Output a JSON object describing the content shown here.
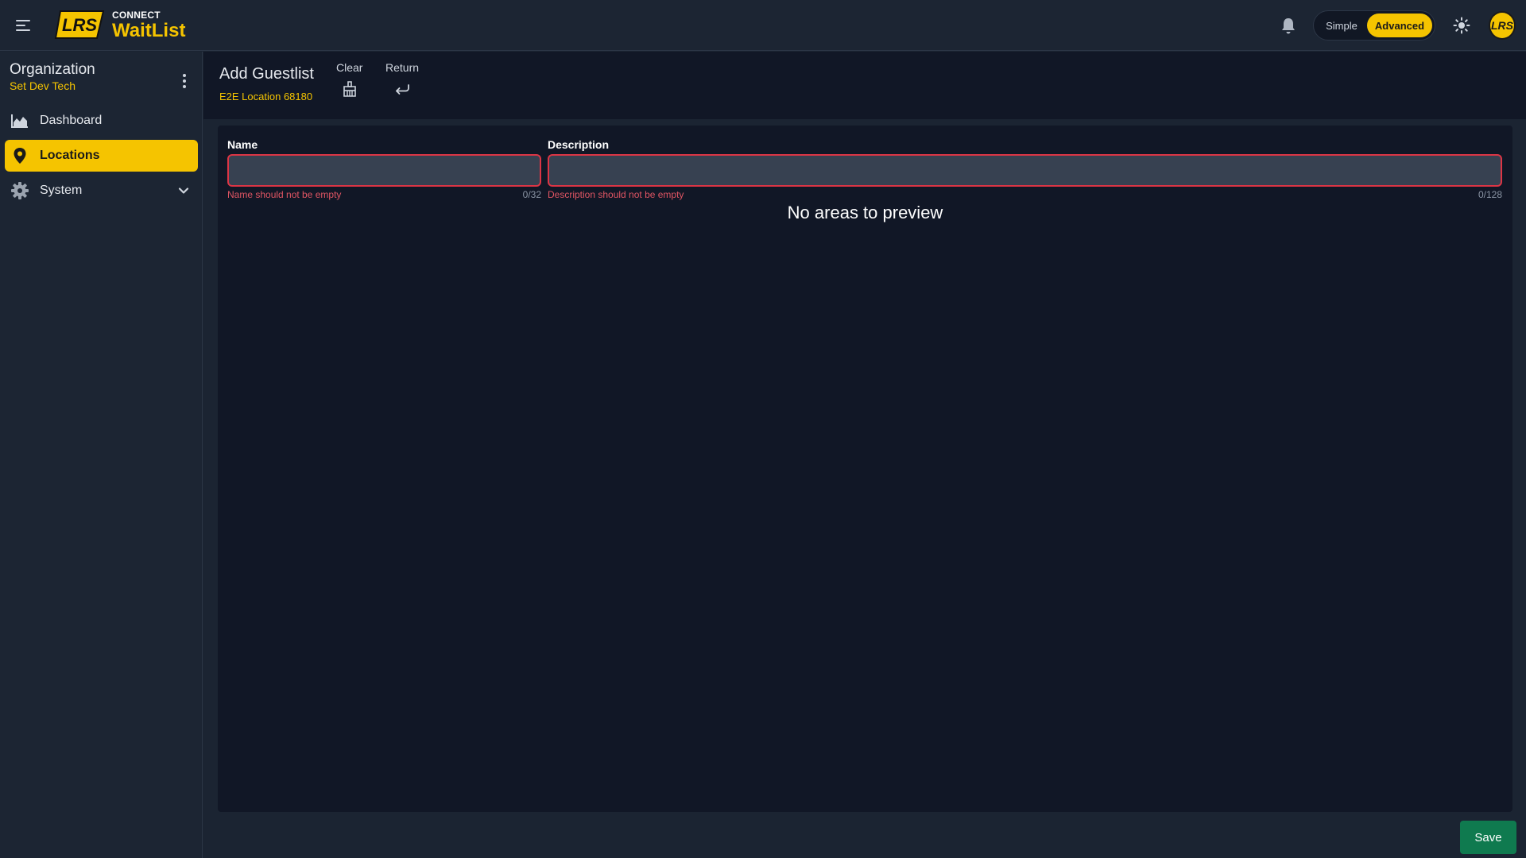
{
  "app": {
    "brand_top": "CONNECT",
    "brand_main": "WaitList",
    "logo_text": "LRS",
    "accent_color": "#f5c400"
  },
  "topbar": {
    "mode_simple": "Simple",
    "mode_advanced": "Advanced",
    "mode_selected": "Advanced",
    "avatar_text": "LRS"
  },
  "sidebar": {
    "org_title": "Organization",
    "org_name": "Set Dev Tech",
    "items": [
      {
        "label": "Dashboard",
        "icon": "area-chart-icon",
        "active": false
      },
      {
        "label": "Locations",
        "icon": "map-pin-icon",
        "active": true
      },
      {
        "label": "System",
        "icon": "gear-icon",
        "active": false,
        "expandable": true
      }
    ]
  },
  "header": {
    "title": "Add Guestlist",
    "subtitle": "E2E Location 68180",
    "actions": [
      {
        "label": "Clear",
        "icon": "clear-broom-icon"
      },
      {
        "label": "Return",
        "icon": "return-arrow-icon"
      }
    ]
  },
  "form": {
    "name": {
      "label": "Name",
      "value": "",
      "placeholder": "",
      "error": "Name should not be empty",
      "counter": "0/32"
    },
    "description": {
      "label": "Description",
      "value": "",
      "placeholder": "",
      "error": "Description should not be empty",
      "counter": "0/128"
    },
    "empty_message": "No areas to preview"
  },
  "footer": {
    "save_label": "Save",
    "save_color": "#0f7a4f"
  }
}
